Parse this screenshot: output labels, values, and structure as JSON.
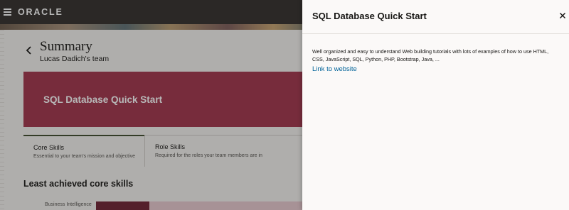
{
  "header": {
    "logo_text": "ORACLE",
    "menu_icon": "hamburger-menu-icon"
  },
  "summary": {
    "title": "Summary",
    "subtitle": "Lucas Dadich's team",
    "back_icon": "chevron-left-icon"
  },
  "hero": {
    "title": "SQL Database Quick Start",
    "color": "#a1334a"
  },
  "tabs": [
    {
      "label": "Core Skills",
      "description": "Essential to your team's mission and objective"
    },
    {
      "label": "Role Skills",
      "description": "Required for the roles your team members are in"
    }
  ],
  "least_achieved": {
    "heading": "Least achieved core skills",
    "skills": [
      {
        "name": "Business Intelligence",
        "achieved_fraction": 0.26
      }
    ]
  },
  "drawer": {
    "title": "SQL Database Quick Start",
    "close_icon": "close-icon",
    "description": "Well organized and easy to understand Web building tutorials with lots of examples of how to use HTML, CSS, JavaScript, SQL, Python, PHP, Bootstrap, Java, ...",
    "link_text": "Link to website"
  },
  "colors": {
    "topbar": "#312d2a",
    "link": "#04659a",
    "bar_fill": "#6e1f31",
    "bar_track": "#e8c9cf"
  }
}
